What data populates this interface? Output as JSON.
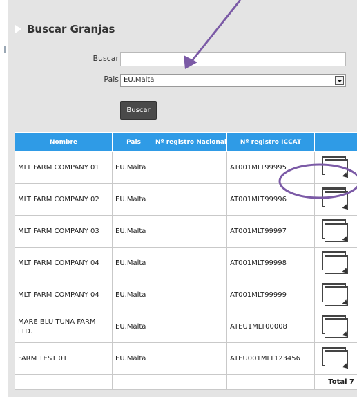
{
  "panel": {
    "title": "Buscar Granjas"
  },
  "form": {
    "buscar_label": "Buscar",
    "buscar_value": "",
    "pais_label": "Pais",
    "pais_value": "EU.Malta",
    "submit_label": "Buscar"
  },
  "table": {
    "headers": {
      "nombre": "Nombre",
      "pais": "Pais",
      "nacional": "Nº registro Nacional",
      "iccat": "Nº registro ICCAT"
    },
    "rows": [
      {
        "nombre": "MLT FARM COMPANY 01",
        "pais": "EU.Malta",
        "nacional": "",
        "iccat": "AT001MLT99995"
      },
      {
        "nombre": "MLT FARM COMPANY 02",
        "pais": "EU.Malta",
        "nacional": "",
        "iccat": "AT001MLT99996"
      },
      {
        "nombre": "MLT FARM COMPANY 03",
        "pais": "EU.Malta",
        "nacional": "",
        "iccat": "AT001MLT99997"
      },
      {
        "nombre": "MLT FARM COMPANY 04",
        "pais": "EU.Malta",
        "nacional": "",
        "iccat": "AT001MLT99998"
      },
      {
        "nombre": "MLT FARM COMPANY 04",
        "pais": "EU.Malta",
        "nacional": "",
        "iccat": "AT001MLT99999"
      },
      {
        "nombre": "MARE BLU TUNA FARM LTD.",
        "pais": "EU.Malta",
        "nacional": "",
        "iccat": "ATEU1MLT00008"
      },
      {
        "nombre": "FARM TEST 01",
        "pais": "EU.Malta",
        "nacional": "",
        "iccat": "ATEU001MLT123456"
      }
    ],
    "total_label": "Total 7"
  },
  "colors": {
    "header_blue": "#2f9be6",
    "panel_gray": "#e4e4e4",
    "annotation_purple": "#7b5aa6"
  },
  "icons": {
    "row_action": "open-window-icon"
  }
}
